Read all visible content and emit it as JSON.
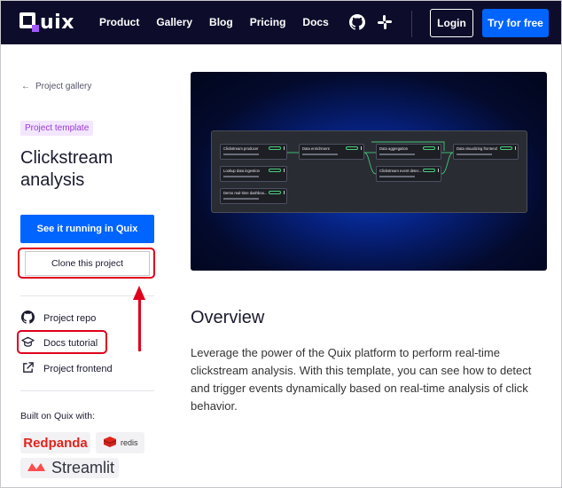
{
  "nav": {
    "logo_text": "uix",
    "links": [
      "Product",
      "Gallery",
      "Blog",
      "Pricing",
      "Docs"
    ],
    "login_label": "Login",
    "try_label": "Try for free"
  },
  "sidebar": {
    "back_label": "Project gallery",
    "badge": "Project template",
    "title": "Clickstream analysis",
    "run_button": "See it running in Quix",
    "clone_button": "Clone this project",
    "links": [
      {
        "label": "Project repo",
        "icon": "github-icon"
      },
      {
        "label": "Docs tutorial",
        "icon": "graduation-cap-icon"
      },
      {
        "label": "Project frontend",
        "icon": "external-link-icon"
      }
    ],
    "built_on": "Built on Quix with:",
    "tech": [
      "Redpanda",
      "redis",
      "Streamlit"
    ]
  },
  "pipeline": {
    "nodes": [
      "Clickstream producer",
      "Lookup data ingestion",
      "Demo real-time dashboa...",
      "Data enrichment",
      "Data aggregation",
      "Clickstream event detec...",
      "Data visualizing frontend"
    ]
  },
  "overview": {
    "title": "Overview",
    "text": "Leverage the power of the Quix platform to perform real-time clickstream analysis. With this template, you can see how to detect and trigger events dynamically based on real-time analysis of click behavior."
  },
  "colors": {
    "nav_bg": "#0d0d2b",
    "primary": "#0064ff",
    "highlight": "#e0001b",
    "badge_bg": "#f3e6ff",
    "badge_text": "#9b3bd8"
  }
}
